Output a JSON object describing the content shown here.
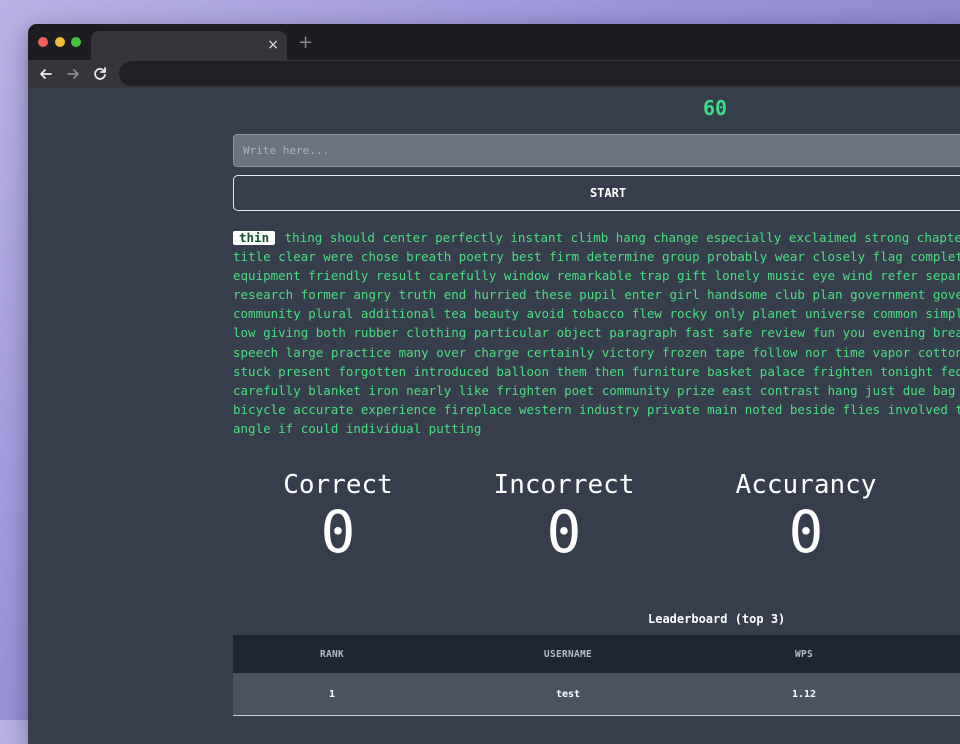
{
  "browser": {
    "tab_close_glyph": "×",
    "new_tab_glyph": "+",
    "icons": [
      "back-arrow-icon",
      "forward-arrow-icon",
      "reload-icon"
    ]
  },
  "game": {
    "timer": "60",
    "input_placeholder": "Write here...",
    "start_label": "START",
    "current_word": "thin",
    "word_lines": [
      "thing should center perfectly instant climb hang change especially exclaimed strong chapter envir",
      "title clear were chose breath poetry best firm determine group probably wear closely flag complete bread",
      "equipment friendly result carefully window remarkable trap gift lonely music eye wind refer separate sud",
      "research former angry truth end hurried these pupil enter girl handsome club plan government government",
      "community plural additional tea beauty avoid tobacco flew rocky only planet universe common simple weigh",
      "low giving both rubber clothing particular object paragraph fast safe review fun you evening breakfast c",
      "speech large practice many over charge certainly victory frozen tape follow nor time vapor cotton dead c",
      "stuck present forgotten introduced balloon them then furniture basket palace frighten tonight fed red st",
      "carefully blanket iron nearly like frighten poet community prize east contrast hang just due bag glass w",
      "bicycle accurate experience fireplace western industry private main noted beside flies involved travel s",
      "angle if could individual putting"
    ]
  },
  "stats": {
    "correct_label": "Correct",
    "correct_value": "0",
    "incorrect_label": "Incorrect",
    "incorrect_value": "0",
    "accuracy_label": "Accurancy",
    "accuracy_value": "0"
  },
  "leaderboard": {
    "title": "Leaderboard (top 3)",
    "headers": [
      "RANK",
      "USERNAME",
      "WPS"
    ],
    "rows": [
      {
        "rank": "1",
        "username": "test",
        "wps": "1.12"
      }
    ]
  },
  "colors": {
    "accent_green": "#4ade80",
    "page_bg": "#363e4d",
    "table_header_bg": "#1e2533"
  }
}
